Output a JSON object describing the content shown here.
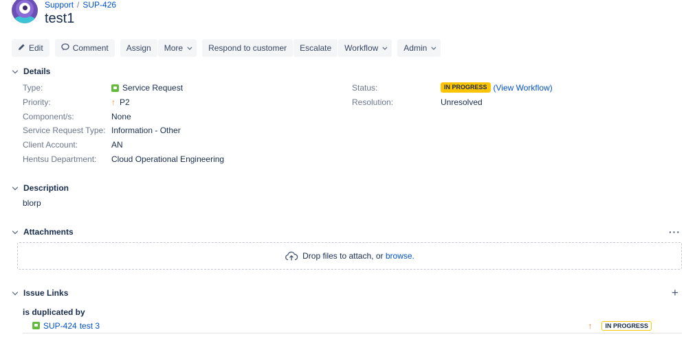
{
  "header": {
    "breadcrumb": {
      "project": "Support",
      "issue_key": "SUP-426"
    },
    "title": "test1"
  },
  "toolbar": {
    "edit": "Edit",
    "comment": "Comment",
    "assign": "Assign",
    "more": "More",
    "respond": "Respond to customer",
    "escalate": "Escalate",
    "workflow": "Workflow",
    "admin": "Admin"
  },
  "details": {
    "heading": "Details",
    "left": [
      {
        "label": "Type:",
        "value": "Service Request",
        "icon": "service-request-icon"
      },
      {
        "label": "Priority:",
        "value": "P2",
        "icon": "priority-arrow-up-icon"
      },
      {
        "label": "Component/s:",
        "value": "None"
      },
      {
        "label": "Service Request Type:",
        "value": "Information - Other"
      },
      {
        "label": "Client Account:",
        "value": "AN"
      },
      {
        "label": "Hentsu Department:",
        "value": "Cloud Operational Engineering"
      }
    ],
    "right": {
      "status_label": "Status:",
      "status_value": "IN PROGRESS",
      "view_workflow": "(View Workflow)",
      "resolution_label": "Resolution:",
      "resolution_value": "Unresolved"
    }
  },
  "description": {
    "heading": "Description",
    "text": "blorp"
  },
  "attachments": {
    "heading": "Attachments",
    "drop_text": "Drop files to attach, or",
    "browse": "browse."
  },
  "issue_links": {
    "heading": "Issue Links",
    "link_type": "is duplicated by",
    "items": [
      {
        "key": "SUP-424",
        "summary": "test 3",
        "status": "IN PROGRESS"
      }
    ]
  },
  "colors": {
    "link": "#0052cc",
    "status_yellow": "#ffc400",
    "priority_orange": "#f57e2a",
    "service_request_green": "#63ba3c"
  }
}
